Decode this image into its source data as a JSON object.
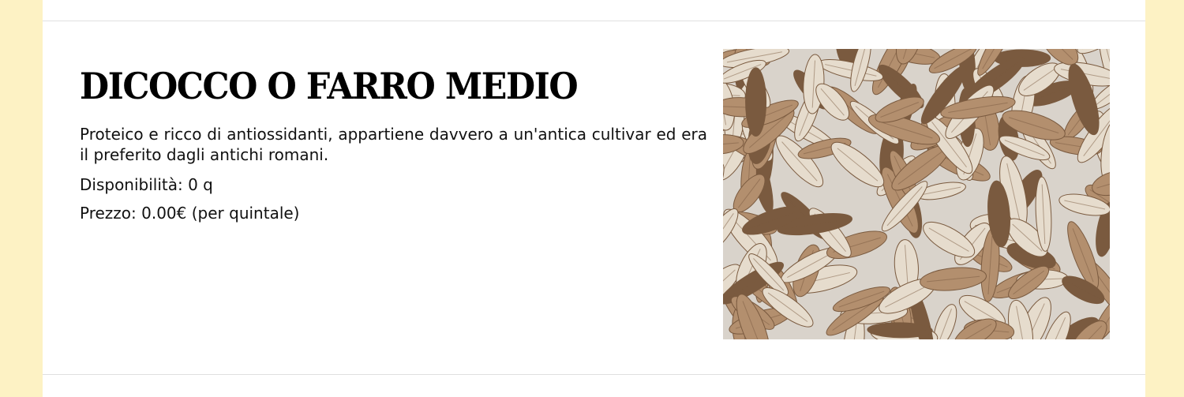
{
  "product": {
    "title": "DICOCCO O FARRO MEDIO",
    "description": "Proteico e ricco di antiossidanti, appartiene davvero a un'antica cultivar ed era il preferito dagli antichi romani.",
    "availability": "Disponibilità: 0 q",
    "price": "Prezzo: 0.00€ (per quintale)",
    "image": {
      "icon": "grain-photo",
      "colors": {
        "background": "#d9d3cb",
        "grain_light": "#e6dccd",
        "grain_mid": "#b38f6e",
        "grain_dark": "#7a5a3f"
      }
    }
  },
  "theme": {
    "page_background": "#fdf2c4",
    "content_background": "#ffffff",
    "divider": "#e0e0e0"
  }
}
